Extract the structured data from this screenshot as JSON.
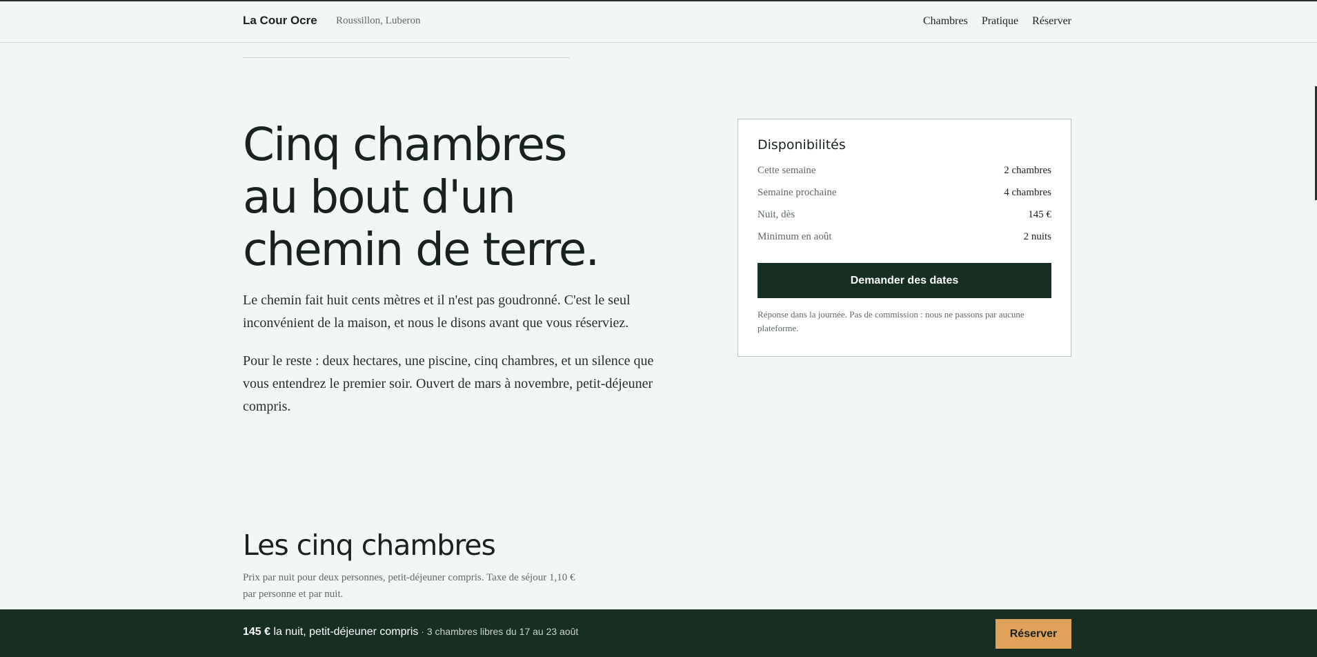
{
  "header": {
    "brand": "La Cour Ocre",
    "location": "Roussillon, Luberon",
    "nav": [
      "Chambres",
      "Pratique",
      "Réserver"
    ]
  },
  "hero": {
    "title_lines": [
      "Cinq chambres",
      "au bout d'un",
      "chemin de terre."
    ],
    "paragraph1": "Le chemin fait huit cents mètres et il n'est pas goudronné. C'est le seul inconvénient de la maison, et nous le disons avant que vous réserviez.",
    "paragraph2": "Pour le reste : deux hectares, une piscine, cinq chambres, et un silence que vous entendrez le premier soir. Ouvert de mars à novembre, petit-déjeuner compris."
  },
  "availability": {
    "title": "Disponibilités",
    "rows": [
      {
        "label": "Cette semaine",
        "value": "2 chambres"
      },
      {
        "label": "Semaine prochaine",
        "value": "4 chambres"
      },
      {
        "label": "Nuit, dès",
        "value": "145 €"
      },
      {
        "label": "Minimum en août",
        "value": "2 nuits"
      }
    ],
    "button": "Demander des dates",
    "note": "Réponse dans la journée. Pas de commission : nous ne passons par aucune plateforme."
  },
  "rooms": {
    "title": "Les cinq chambres",
    "subtitle": "Prix par nuit pour deux personnes, petit-déjeuner compris. Taxe de séjour 1,10 € par personne et par nuit."
  },
  "bottom_bar": {
    "price": "145 €",
    "price_suffix": " la nuit, petit-déjeuner compris",
    "availability": " · 3 chambres libres du 17 au 23 août",
    "button": "Réserver"
  },
  "colors": {
    "background": "#f3f7f4",
    "dark_green": "#172e22",
    "accent": "#e0a15a"
  }
}
